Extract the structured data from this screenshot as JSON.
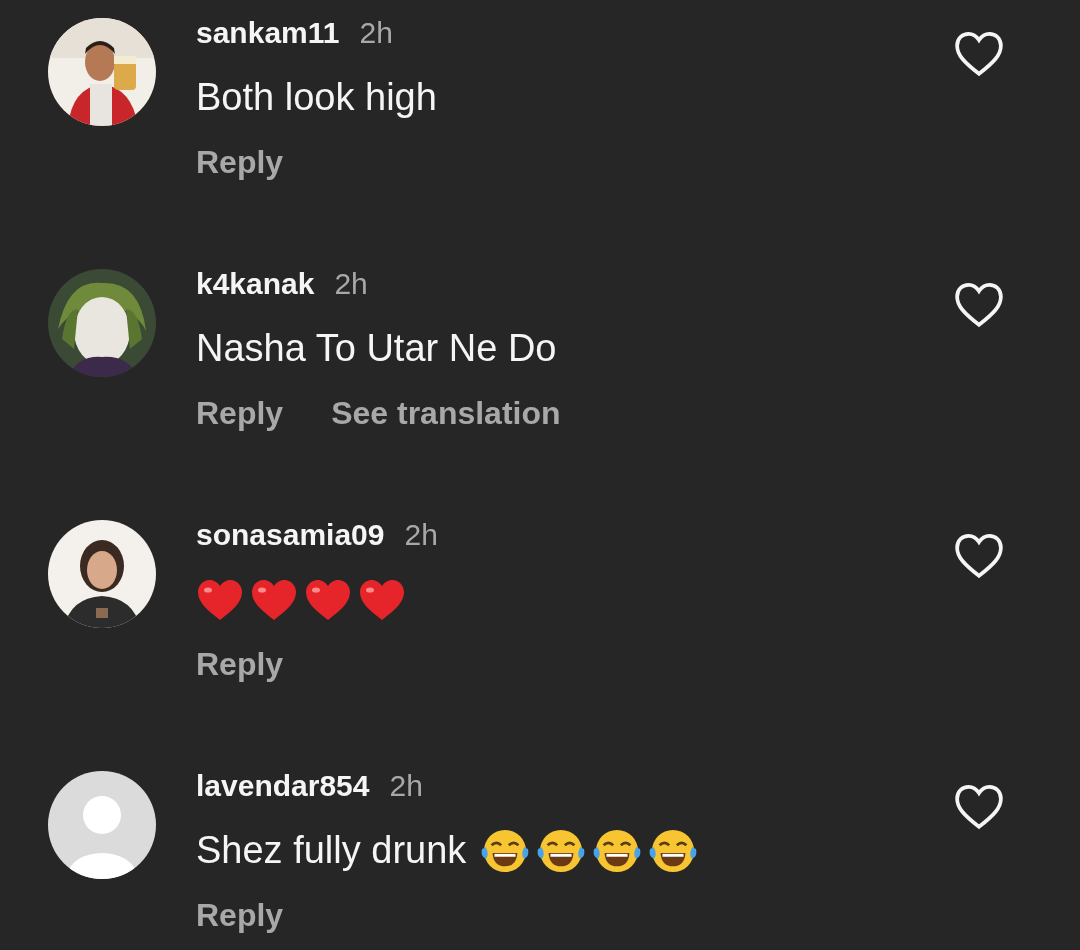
{
  "comments": [
    {
      "avatar": {
        "kind": "picture"
      },
      "username": "sankam11",
      "time": "2h",
      "text": "Both look high",
      "actions": [
        "Reply"
      ],
      "liked": false
    },
    {
      "avatar": {
        "kind": "picture"
      },
      "username": "k4kanak",
      "time": "2h",
      "text": "Nasha To Utar Ne Do",
      "actions": [
        "Reply",
        "See translation"
      ],
      "liked": false
    },
    {
      "avatar": {
        "kind": "picture"
      },
      "username": "sonasamia09",
      "time": "2h",
      "emojis": [
        {
          "kind": "heart"
        },
        {
          "kind": "heart"
        },
        {
          "kind": "heart"
        },
        {
          "kind": "heart"
        }
      ],
      "actions": [
        "Reply"
      ],
      "liked": false
    },
    {
      "avatar": {
        "kind": "default"
      },
      "username": "lavendar854",
      "time": "2h",
      "text": "Shez fully drunk",
      "emojis": [
        {
          "kind": "laughing"
        },
        {
          "kind": "laughing"
        },
        {
          "kind": "laughing"
        },
        {
          "kind": "laughing"
        }
      ],
      "actions": [
        "Reply"
      ],
      "liked": false
    }
  ]
}
